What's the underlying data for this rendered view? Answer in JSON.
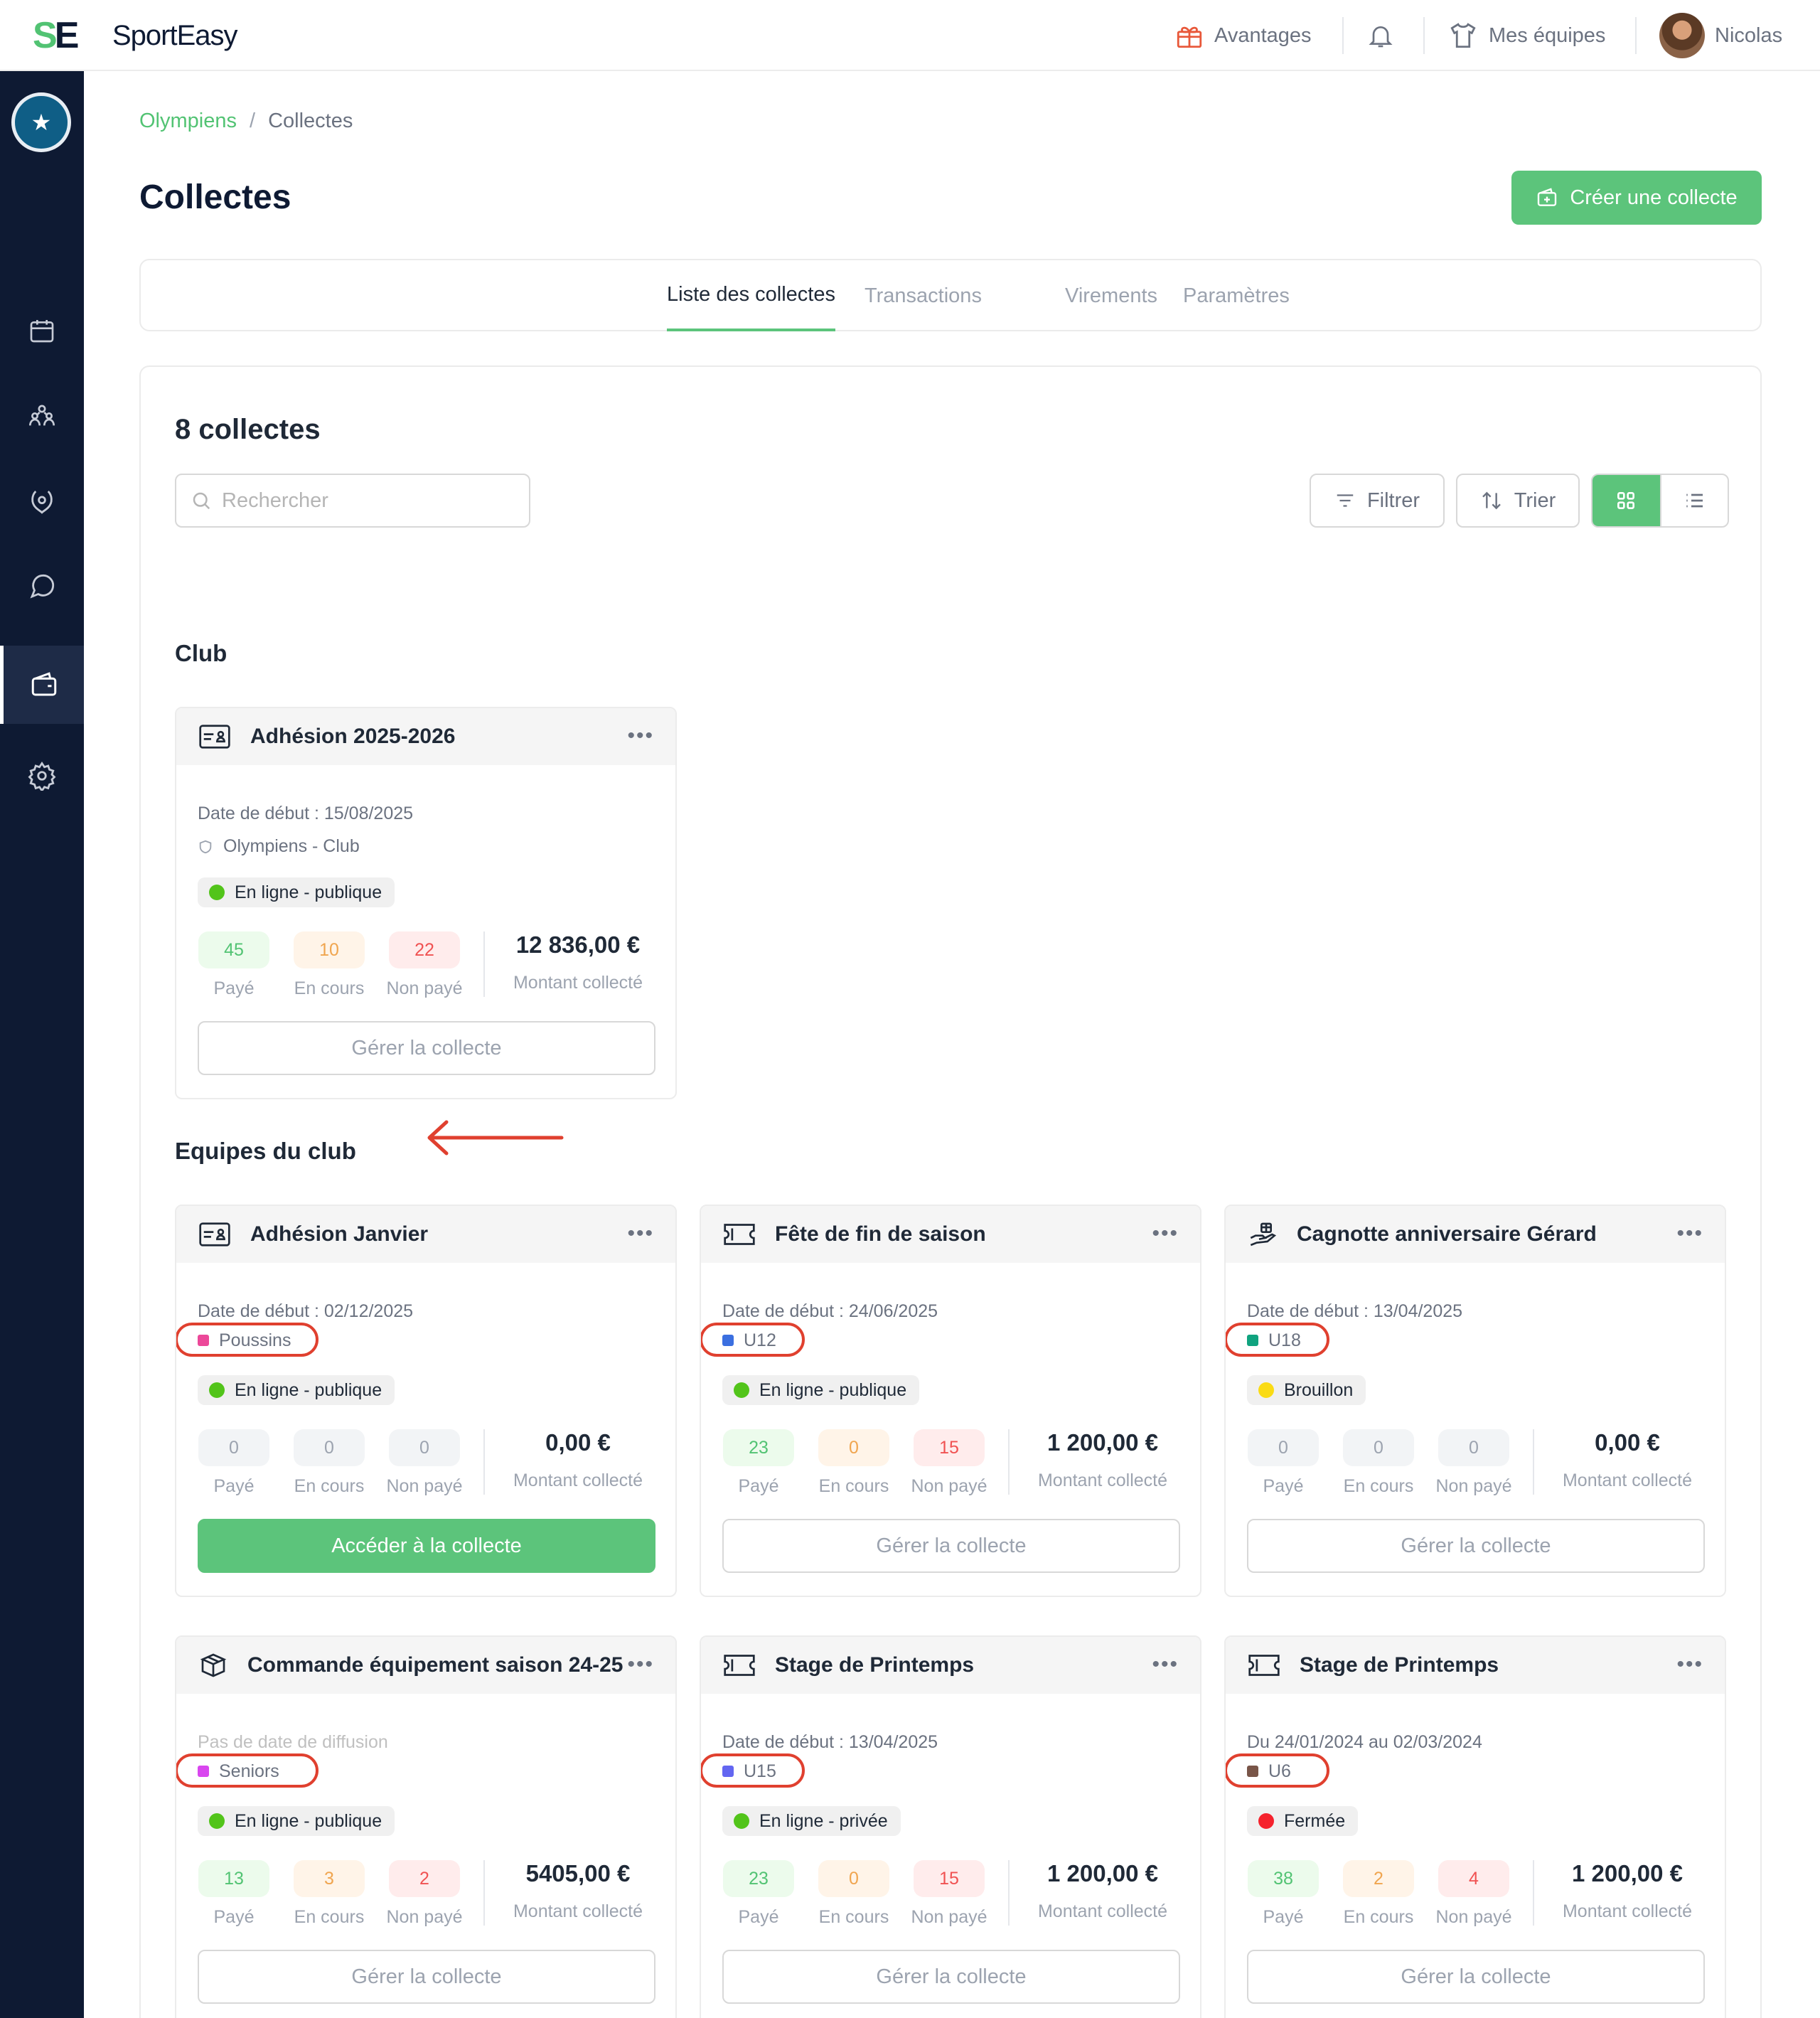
{
  "brand": {
    "mark_s": "S",
    "mark_e": "E",
    "name": "SportEasy"
  },
  "topnav": {
    "advantages": "Avantages",
    "my_teams": "Mes équipes",
    "user": "Nicolas"
  },
  "breadcrumb": {
    "club": "Olympiens",
    "separator": "/",
    "current": "Collectes"
  },
  "page": {
    "title": "Collectes",
    "create_button": "Créer une collecte"
  },
  "tabs": [
    {
      "label": "Liste des collectes",
      "active": true
    },
    {
      "label": "Transactions",
      "active": false
    },
    {
      "label": "Virements",
      "active": false
    },
    {
      "label": "Paramètres",
      "active": false
    }
  ],
  "panel": {
    "count": "8 collectes",
    "search_placeholder": "Rechercher",
    "filter": "Filtrer",
    "sort": "Trier"
  },
  "sections": {
    "club": "Club",
    "teams": "Equipes du club"
  },
  "labels": {
    "paid": "Payé",
    "pending": "En cours",
    "unpaid": "Non payé",
    "collected": "Montant collecté"
  },
  "cards": [
    {
      "title": "Adhésion 2025-2026",
      "icon": "id-card-icon",
      "date": "Date de début : 15/08/2025",
      "owner": "Olympiens - Club",
      "status": "En ligne - publique",
      "status_color": "#52c41a",
      "paid": "45",
      "pending": "10",
      "unpaid": "22",
      "amount": "12 836,00 €",
      "button": "Gérer la collecte"
    },
    {
      "title": "Adhésion Janvier",
      "icon": "id-card-icon",
      "date": "Date de début : 02/12/2025",
      "team": "Poussins",
      "team_color": "#ec4899",
      "status": "En ligne - publique",
      "status_color": "#52c41a",
      "paid": "0",
      "pending": "0",
      "unpaid": "0",
      "amount": "0,00 €",
      "button": "Accéder à la collecte"
    },
    {
      "title": "Fête de fin de saison",
      "icon": "ticket-icon",
      "date": "Date de début : 24/06/2025",
      "team": "U12",
      "team_color": "#3b6fe0",
      "status": "En ligne - publique",
      "status_color": "#52c41a",
      "paid": "23",
      "pending": "0",
      "unpaid": "15",
      "amount": "1 200,00 €",
      "button": "Gérer la collecte"
    },
    {
      "title": "Cagnotte anniversaire Gérard",
      "icon": "gift-hand-icon",
      "date": "Date de début : 13/04/2025",
      "team": "U18",
      "team_color": "#10a37f",
      "status": "Brouillon",
      "status_color": "#fadb14",
      "paid": "0",
      "pending": "0",
      "unpaid": "0",
      "amount": "0,00 €",
      "button": "Gérer la collecte"
    },
    {
      "title": "Commande équipement saison 24-25",
      "icon": "package-icon",
      "date": "Pas de date de diffusion",
      "team": "Seniors",
      "team_color": "#d946ef",
      "status": "En ligne - publique",
      "status_color": "#52c41a",
      "paid": "13",
      "pending": "3",
      "unpaid": "2",
      "amount": "5405,00 €",
      "button": "Gérer la collecte"
    },
    {
      "title": "Stage de Printemps",
      "icon": "ticket-icon",
      "date": "Date de début : 13/04/2025",
      "team": "U15",
      "team_color": "#6366f1",
      "status": "En ligne - privée",
      "status_color": "#52c41a",
      "paid": "23",
      "pending": "0",
      "unpaid": "15",
      "amount": "1 200,00 €",
      "button": "Gérer la collecte"
    },
    {
      "title": "Stage de Printemps",
      "icon": "ticket-icon",
      "date": "Du 24/01/2024 au 02/03/2024",
      "team": "U6",
      "team_color": "#795548",
      "status": "Fermée",
      "status_color": "#f5222d",
      "paid": "38",
      "pending": "2",
      "unpaid": "4",
      "amount": "1 200,00 €",
      "button": "Gérer la collecte"
    }
  ],
  "colors": {
    "accent": "#5cc47b",
    "sidebar": "#0e1a33",
    "highlight": "#e0402f"
  }
}
